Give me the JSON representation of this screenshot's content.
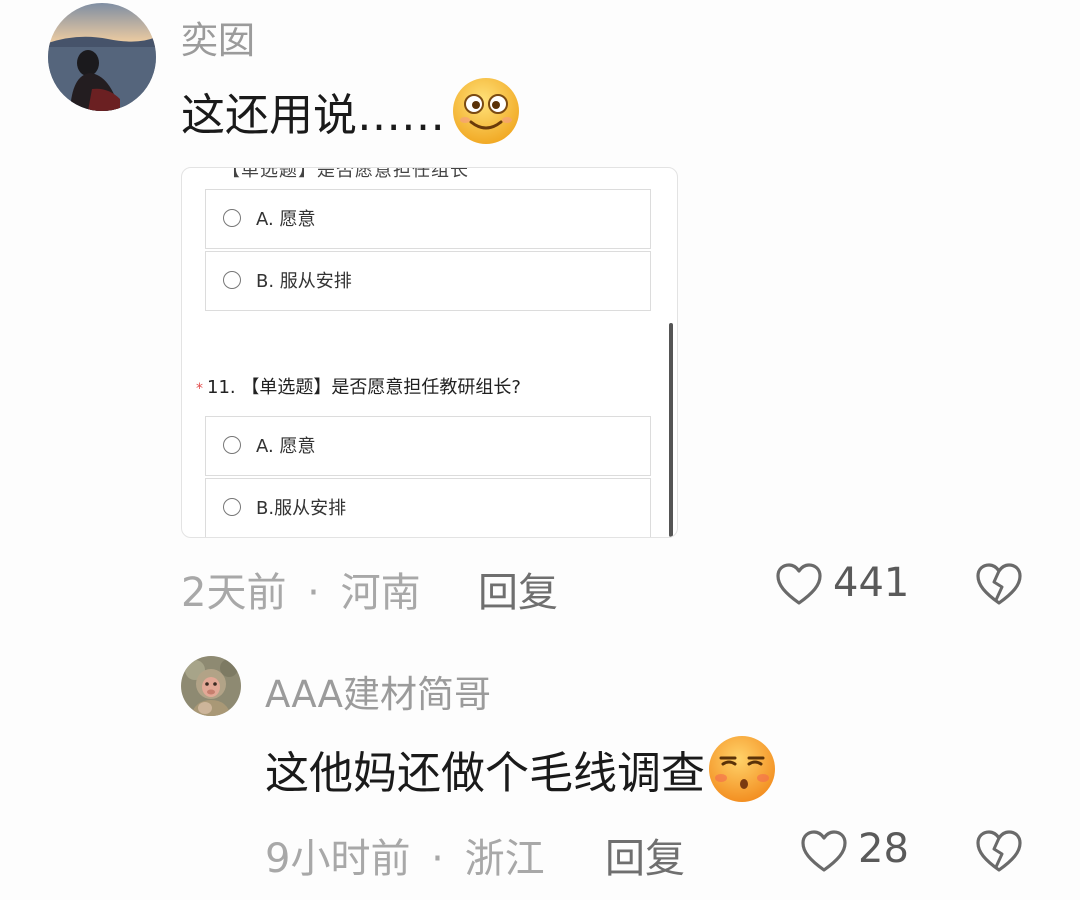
{
  "comments": [
    {
      "username": "奕囡",
      "text": "这还用说……",
      "emoji": "grinning-face-emoji",
      "survey": {
        "cut_off_text": "【单选题】是否愿意担任组长",
        "options_top": [
          {
            "label": "A. 愿意"
          },
          {
            "label": "B. 服从安排"
          }
        ],
        "question": {
          "required_mark": "*",
          "number": "11.",
          "text": "【单选题】是否愿意担任教研组长?"
        },
        "options_bottom": [
          {
            "label": "A. 愿意"
          },
          {
            "label": "B.服从安排"
          }
        ]
      },
      "time": "2天前",
      "separator": "·",
      "location": "河南",
      "reply_label": "回复",
      "like_count": "441"
    },
    {
      "username": "AAA建材简哥",
      "text": "这他妈还做个毛线调查",
      "emoji": "unamused-face-emoji",
      "time": "9小时前",
      "separator": "·",
      "location": "浙江",
      "reply_label": "回复",
      "like_count": "28"
    }
  ],
  "colors": {
    "background": "#fdfdfd",
    "username": "#9b9b9b",
    "meta": "#a8a8a8",
    "required": "#e24b4b"
  },
  "icons": {
    "like": "heart-outline-icon",
    "dislike": "broken-heart-icon"
  }
}
